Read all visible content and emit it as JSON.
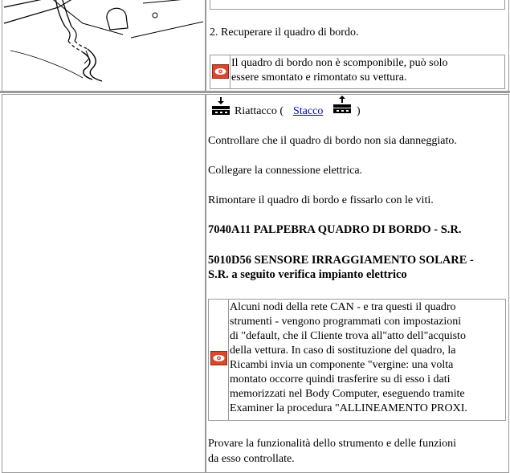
{
  "top_section": {
    "step_text": "2. Recuperare il quadro di bordo.",
    "note_lines": [
      "Il quadro di bordo non è scomponibile, può solo",
      "essere smontato e rimontato su vettura."
    ]
  },
  "main_section": {
    "refit_label": "Riattacco (",
    "remove_link": "Stacco",
    "close_paren": ")",
    "paragraphs": [
      "Controllare che il quadro di bordo non sia danneggiato.",
      "Collegare la connessione elettrica.",
      "Rimontare il quadro di bordo e fissarlo con le viti."
    ],
    "ref1": "7040A11 PALPEBRA QUADRO DI BORDO - S.R.",
    "ref2_line1": "5010D56 SENSORE IRRAGGIAMENTO SOLARE -",
    "ref2_line2": "S.R. a seguito verifica impianto elettrico",
    "note_lines": [
      "Alcuni nodi della rete CAN - e tra questi il quadro",
      "strumenti - vengono programmati con impostazioni",
      "di \"default, che il Cliente trova all\"atto dell\"acquisto",
      "della vettura. In caso di sostituzione del quadro, la",
      "Ricambi invia un componente \"vergine: una volta",
      "montato occorre quindi trasferire su di esso i dati",
      "memorizzati nel Body Computer, eseguendo tramite",
      "Examiner la procedura \"ALLINEAMENTO PROXI."
    ],
    "final_lines": [
      "Provare la funzionalità dello strumento e delle funzioni",
      "da esso controllate."
    ]
  },
  "icons": {
    "note": "eye-warning-icon",
    "refit": "connector-down-icon",
    "remove": "connector-up-icon"
  },
  "colors": {
    "note_icon": "#d9482c",
    "link": "#0000cc",
    "border": "#9a9a9a"
  }
}
